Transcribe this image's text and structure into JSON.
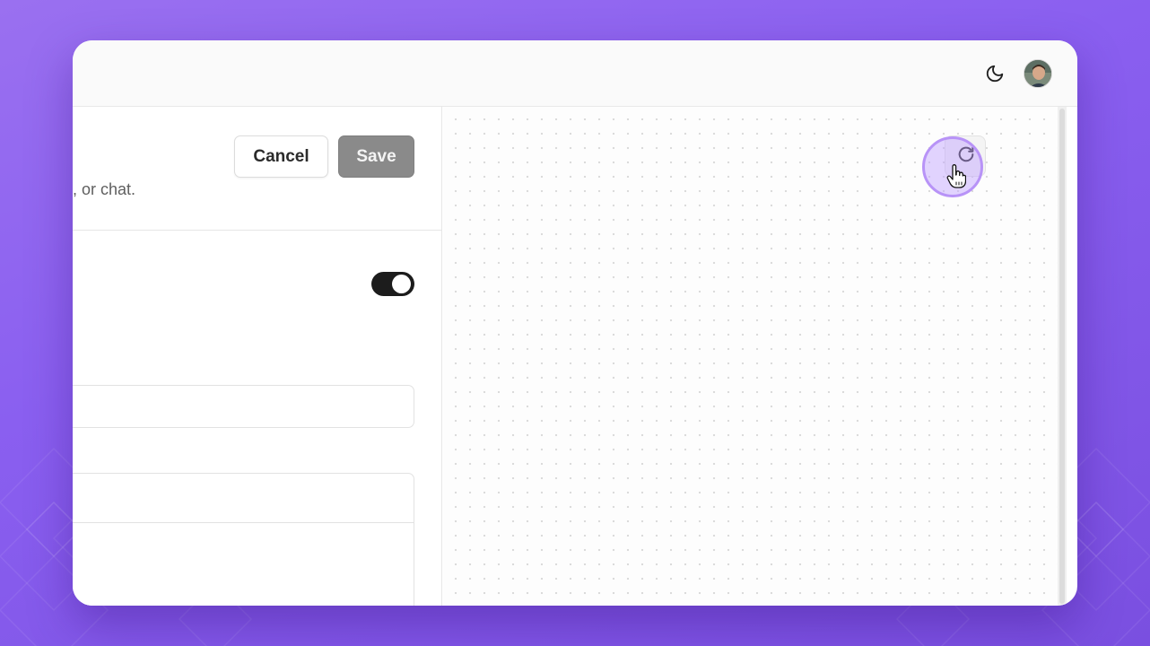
{
  "header": {
    "theme_toggle_icon": "moon-icon",
    "avatar_icon": "user-avatar"
  },
  "editor": {
    "cancel_label": "Cancel",
    "save_label": "Save",
    "description": ", or chat.",
    "toggle_on": true
  },
  "preview": {
    "refresh_icon": "refresh-icon",
    "cursor_icon": "hand-pointer-icon"
  },
  "colors": {
    "background": "#8a5ff0",
    "toggle_on": "#1c1c1c",
    "save_disabled": "#8a8a8a",
    "click_highlight": "#b893f7"
  }
}
